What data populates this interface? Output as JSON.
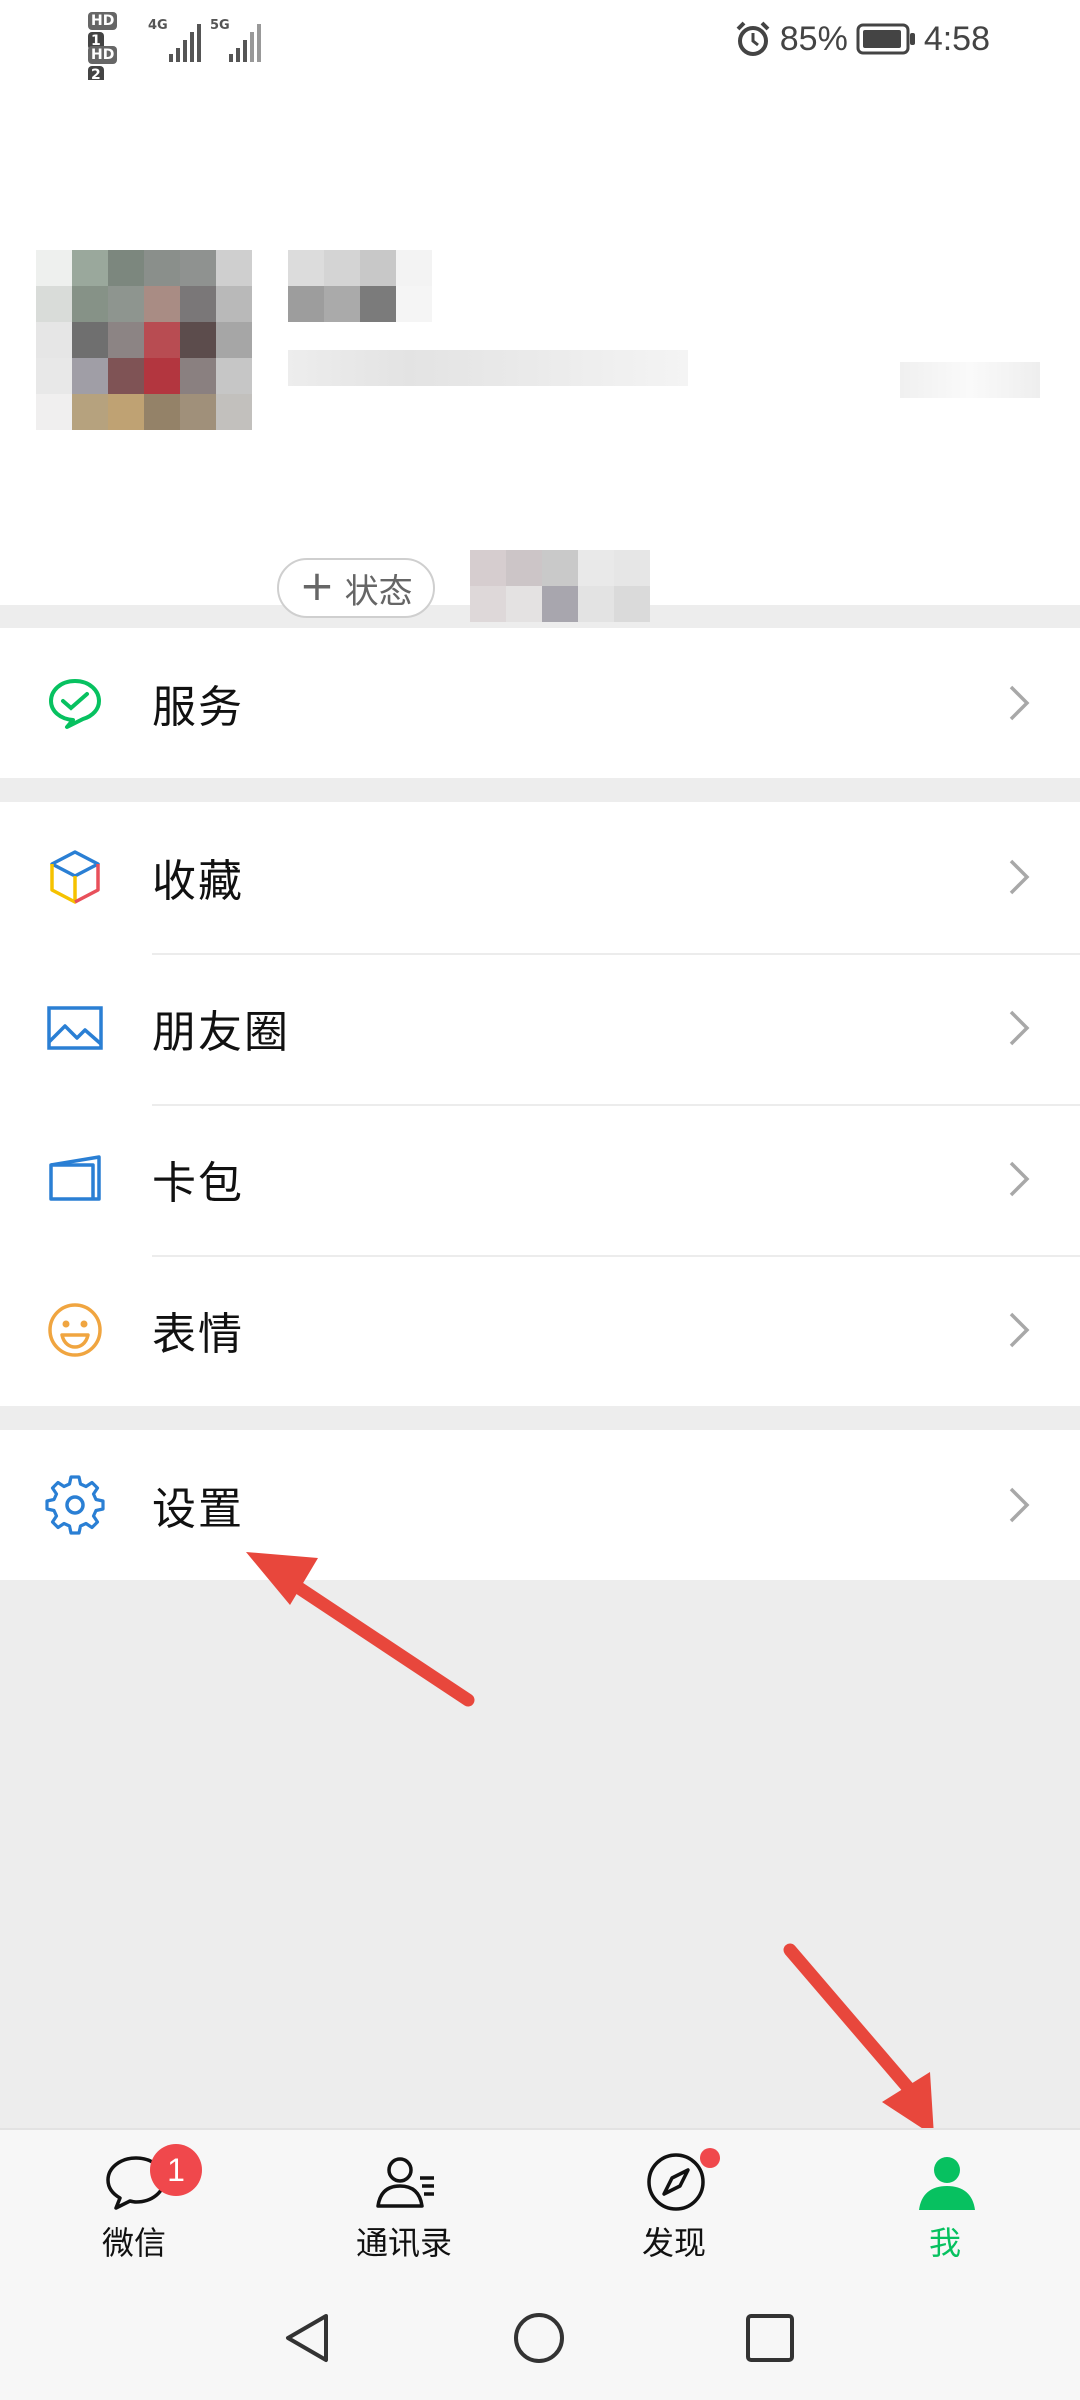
{
  "status_bar": {
    "sim1": "HD",
    "sim1_slot": "1",
    "sim2": "HD",
    "sim2_slot": "2",
    "net1": "4G",
    "net2": "5G",
    "battery": "85%",
    "time": "4:58"
  },
  "profile": {
    "status_button": "状态"
  },
  "menu": {
    "services": "服务",
    "favorites": "收藏",
    "moments": "朋友圈",
    "cards": "卡包",
    "stickers": "表情",
    "settings": "设置"
  },
  "tabs": {
    "chats": {
      "label": "微信",
      "badge": "1"
    },
    "contacts": {
      "label": "通讯录"
    },
    "discover": {
      "label": "发现"
    },
    "me": {
      "label": "我"
    }
  },
  "colors": {
    "accent_green": "#07c160",
    "badge_red": "#f0484c",
    "annotation_red": "#e8473c",
    "icon_blue": "#2a7fd4",
    "emoji_orange": "#f0a540"
  }
}
